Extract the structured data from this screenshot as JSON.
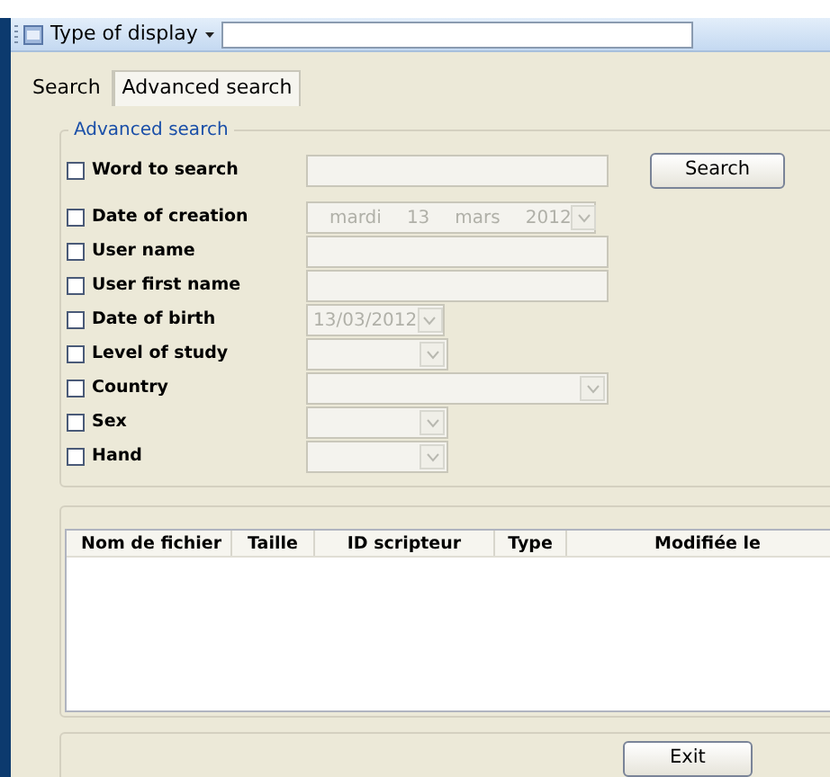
{
  "toolbar": {
    "label": "Type of display"
  },
  "tabs": [
    {
      "label": "Search",
      "selected": false
    },
    {
      "label": "Advanced search",
      "selected": true
    }
  ],
  "group": {
    "title": "Advanced search"
  },
  "criteria": [
    {
      "label": "Word to search",
      "checked": false,
      "kind": "text"
    },
    {
      "label": "Date of creation",
      "checked": false,
      "kind": "long-date",
      "parts": [
        "mardi",
        "13",
        "mars",
        "2012"
      ]
    },
    {
      "label": "User name",
      "checked": false,
      "kind": "text"
    },
    {
      "label": "User first name",
      "checked": false,
      "kind": "text"
    },
    {
      "label": "Date of birth",
      "checked": false,
      "kind": "short-date",
      "value": "13/03/2012"
    },
    {
      "label": "Level of study",
      "checked": false,
      "kind": "combo"
    },
    {
      "label": "Country",
      "checked": false,
      "kind": "long-combo"
    },
    {
      "label": "Sex",
      "checked": false,
      "kind": "combo"
    },
    {
      "label": "Hand",
      "checked": false,
      "kind": "combo"
    }
  ],
  "search_button": "Search",
  "table": {
    "columns": [
      "Nom de fichier",
      "Taille",
      "ID scripteur",
      "Type",
      "Modifiée le"
    ]
  },
  "exit_button": "Exit"
}
